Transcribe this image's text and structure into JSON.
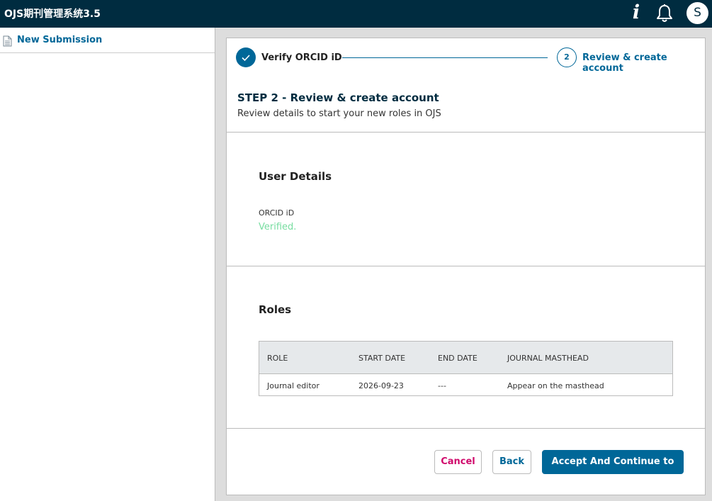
{
  "header": {
    "app_title": "OJS期刊管理系统3.5",
    "help_icon_glyph": "i",
    "avatar_initial": "S"
  },
  "sidebar": {
    "items": [
      {
        "label": "New Submission",
        "icon": "document-icon"
      }
    ]
  },
  "stepper": {
    "steps": [
      {
        "number": "1",
        "label": "Verify ORCID iD",
        "status": "complete"
      },
      {
        "number": "2",
        "label": "Review & create account",
        "status": "current"
      }
    ]
  },
  "page": {
    "heading": "STEP 2 - Review & create account",
    "subheading": "Review details to start your new roles in OJS"
  },
  "user_details": {
    "title": "User Details",
    "orcid_label": "ORCID iD",
    "orcid_status": "Verified."
  },
  "roles": {
    "title": "Roles",
    "columns": [
      "ROLE",
      "START DATE",
      "END DATE",
      "JOURNAL MASTHEAD"
    ],
    "rows": [
      [
        "Journal editor",
        "2026-09-23",
        "---",
        "Appear on the masthead"
      ]
    ]
  },
  "actions": {
    "cancel": "Cancel",
    "back": "Back",
    "accept": "Accept And Continue to OJS"
  },
  "colors": {
    "header_bg": "#002c40",
    "primary": "#006798",
    "cancel": "#d00a6c",
    "verified": "#77dda0"
  }
}
